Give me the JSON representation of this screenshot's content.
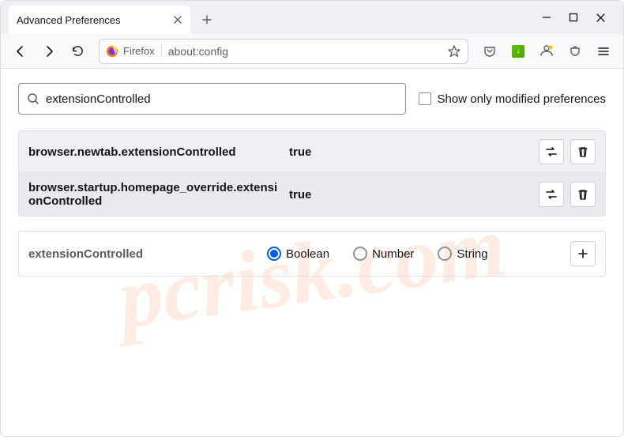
{
  "window": {
    "tab_title": "Advanced Preferences"
  },
  "toolbar": {
    "identity_label": "Firefox",
    "url": "about:config"
  },
  "search": {
    "value": "extensionControlled",
    "checkbox_label": "Show only modified preferences"
  },
  "prefs": [
    {
      "name": "browser.newtab.extensionControlled",
      "value": "true"
    },
    {
      "name": "browser.startup.homepage_override.extensionControlled",
      "value": "true"
    }
  ],
  "add": {
    "name": "extensionControlled",
    "types": {
      "boolean": "Boolean",
      "number": "Number",
      "string": "String"
    },
    "selected": "boolean"
  },
  "watermark": "pcrisk.com"
}
